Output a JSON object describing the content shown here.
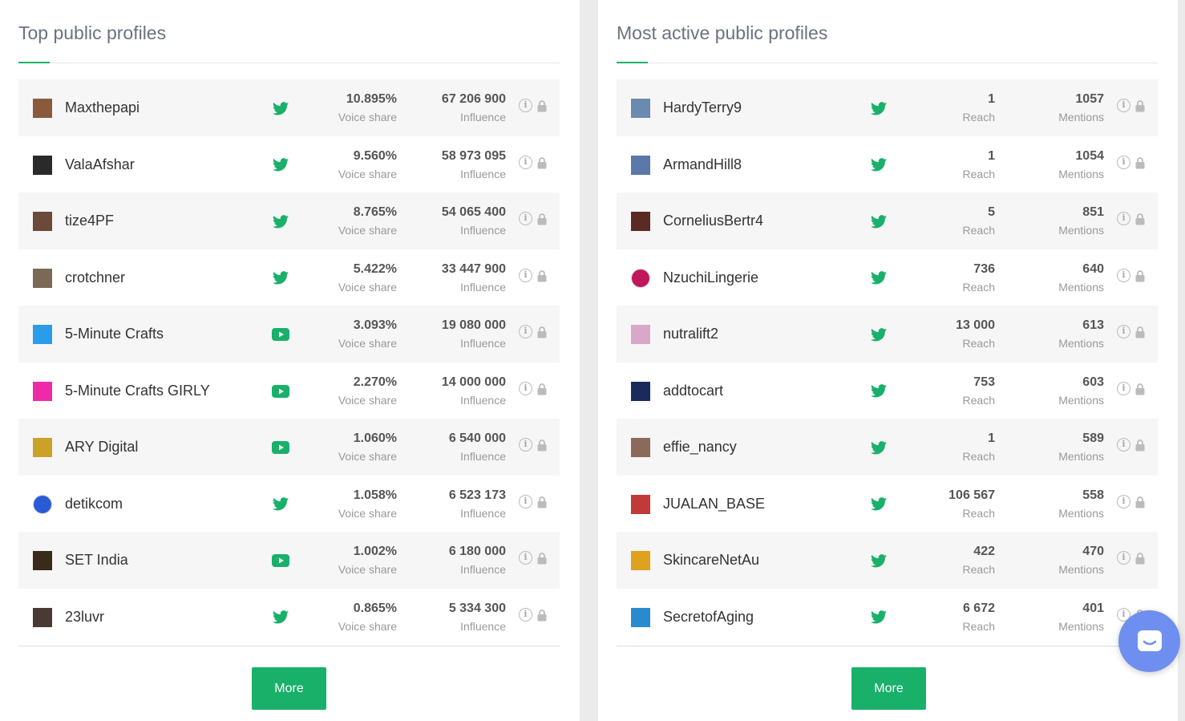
{
  "left_panel": {
    "title": "Top public profiles",
    "more_label": "More",
    "rows": [
      {
        "name": "Maxthepapi",
        "network": "twitter",
        "value1": "10.895%",
        "label1": "Voice share",
        "value2": "67 206 900",
        "label2": "Influence",
        "avatar": "#8a5a3c"
      },
      {
        "name": "ValaAfshar",
        "network": "twitter",
        "value1": "9.560%",
        "label1": "Voice share",
        "value2": "58 973 095",
        "label2": "Influence",
        "avatar": "#2a2a2a"
      },
      {
        "name": "tize4PF",
        "network": "twitter",
        "value1": "8.765%",
        "label1": "Voice share",
        "value2": "54 065 400",
        "label2": "Influence",
        "avatar": "#6b4a3a"
      },
      {
        "name": "crotchner",
        "network": "twitter",
        "value1": "5.422%",
        "label1": "Voice share",
        "value2": "33 447 900",
        "label2": "Influence",
        "avatar": "#7a6a55"
      },
      {
        "name": "5-Minute Crafts",
        "network": "youtube",
        "value1": "3.093%",
        "label1": "Voice share",
        "value2": "19 080 000",
        "label2": "Influence",
        "avatar": "#2b9de8"
      },
      {
        "name": "5-Minute Crafts GIRLY",
        "network": "youtube",
        "value1": "2.270%",
        "label1": "Voice share",
        "value2": "14 000 000",
        "label2": "Influence",
        "avatar": "#ee2aa8"
      },
      {
        "name": "ARY Digital",
        "network": "youtube",
        "value1": "1.060%",
        "label1": "Voice share",
        "value2": "6 540 000",
        "label2": "Influence",
        "avatar": "#c9a227"
      },
      {
        "name": "detikcom",
        "network": "twitter",
        "value1": "1.058%",
        "label1": "Voice share",
        "value2": "6 523 173",
        "label2": "Influence",
        "avatar": "#2a5bd7"
      },
      {
        "name": "SET India",
        "network": "youtube",
        "value1": "1.002%",
        "label1": "Voice share",
        "value2": "6 180 000",
        "label2": "Influence",
        "avatar": "#3a2a1a"
      },
      {
        "name": "23luvr",
        "network": "twitter",
        "value1": "0.865%",
        "label1": "Voice share",
        "value2": "5 334 300",
        "label2": "Influence",
        "avatar": "#4a3a35"
      }
    ]
  },
  "right_panel": {
    "title": "Most active public profiles",
    "more_label": "More",
    "rows": [
      {
        "name": "HardyTerry9",
        "network": "twitter",
        "value1": "1",
        "label1": "Reach",
        "value2": "1057",
        "label2": "Mentions",
        "avatar": "#6a8ab0"
      },
      {
        "name": "ArmandHill8",
        "network": "twitter",
        "value1": "1",
        "label1": "Reach",
        "value2": "1054",
        "label2": "Mentions",
        "avatar": "#5a78a8"
      },
      {
        "name": "CorneliusBertr4",
        "network": "twitter",
        "value1": "5",
        "label1": "Reach",
        "value2": "851",
        "label2": "Mentions",
        "avatar": "#5a2a25"
      },
      {
        "name": "NzuchiLingerie",
        "network": "twitter",
        "value1": "736",
        "label1": "Reach",
        "value2": "640",
        "label2": "Mentions",
        "avatar": "#c0185a"
      },
      {
        "name": "nutralift2",
        "network": "twitter",
        "value1": "13 000",
        "label1": "Reach",
        "value2": "613",
        "label2": "Mentions",
        "avatar": "#d8a8c8"
      },
      {
        "name": "addtocart",
        "network": "twitter",
        "value1": "753",
        "label1": "Reach",
        "value2": "603",
        "label2": "Mentions",
        "avatar": "#1a2a5a"
      },
      {
        "name": "effie_nancy",
        "network": "twitter",
        "value1": "1",
        "label1": "Reach",
        "value2": "589",
        "label2": "Mentions",
        "avatar": "#8a6a5a"
      },
      {
        "name": "JUALAN_BASE",
        "network": "twitter",
        "value1": "106 567",
        "label1": "Reach",
        "value2": "558",
        "label2": "Mentions",
        "avatar": "#c03a3a"
      },
      {
        "name": "SkincareNetAu",
        "network": "twitter",
        "value1": "422",
        "label1": "Reach",
        "value2": "470",
        "label2": "Mentions",
        "avatar": "#e0a020"
      },
      {
        "name": "SecretofAging",
        "network": "twitter",
        "value1": "6 672",
        "label1": "Reach",
        "value2": "401",
        "label2": "Mentions",
        "avatar": "#2a8ad0"
      }
    ]
  },
  "colors": {
    "accent": "#19b06a",
    "chat": "#6f8ff0"
  }
}
